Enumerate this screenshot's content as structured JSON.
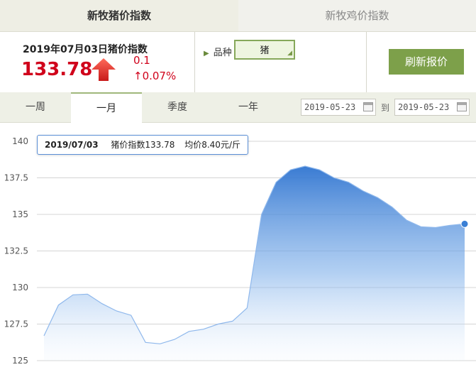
{
  "top_tabs": {
    "pig": "新牧猪价指数",
    "chicken": "新牧鸡价指数"
  },
  "summary": {
    "date_line": "2019年07月03日猪价指数",
    "index_value": "133.78",
    "change_abs": "0.1",
    "change_pct": "↑0.07%",
    "trend_icon": "arrow-up-icon",
    "accent_color": "#d0021b"
  },
  "variety": {
    "label": "品种",
    "value": "猪"
  },
  "refresh_button": "刷新报价",
  "period_tabs": [
    "一周",
    "一月",
    "季度",
    "一年"
  ],
  "active_period": "一月",
  "date_range": {
    "start": "2019-05-23",
    "end": "2019-05-23",
    "separator": "到"
  },
  "tooltip": {
    "date": "2019/07/03",
    "index_text": "猪价指数133.78",
    "avg_text": "均价8.40元/斤"
  },
  "chart_data": {
    "type": "area",
    "ylim": [
      125,
      140
    ],
    "yticks": [
      125,
      127.5,
      130,
      132.5,
      135,
      137.5,
      140
    ],
    "ytick_labels": [
      "125",
      "127.5",
      "130",
      "132.5",
      "135",
      "137.5",
      "140"
    ],
    "grid": true,
    "series_color": "#3a7fd5",
    "series": [
      {
        "values": [
          126.7,
          128.8,
          129.5,
          129.55,
          128.9,
          128.4,
          128.1,
          126.25,
          126.15,
          126.45,
          127.0,
          127.15,
          127.5,
          127.7,
          128.6,
          135.0,
          137.2,
          138.05,
          138.3,
          138.05,
          137.5,
          137.2,
          136.6,
          136.15,
          135.5,
          134.6,
          134.15,
          134.1,
          134.25,
          134.35
        ]
      }
    ],
    "highlighted_point": {
      "index": 29,
      "value": 134.35
    }
  }
}
